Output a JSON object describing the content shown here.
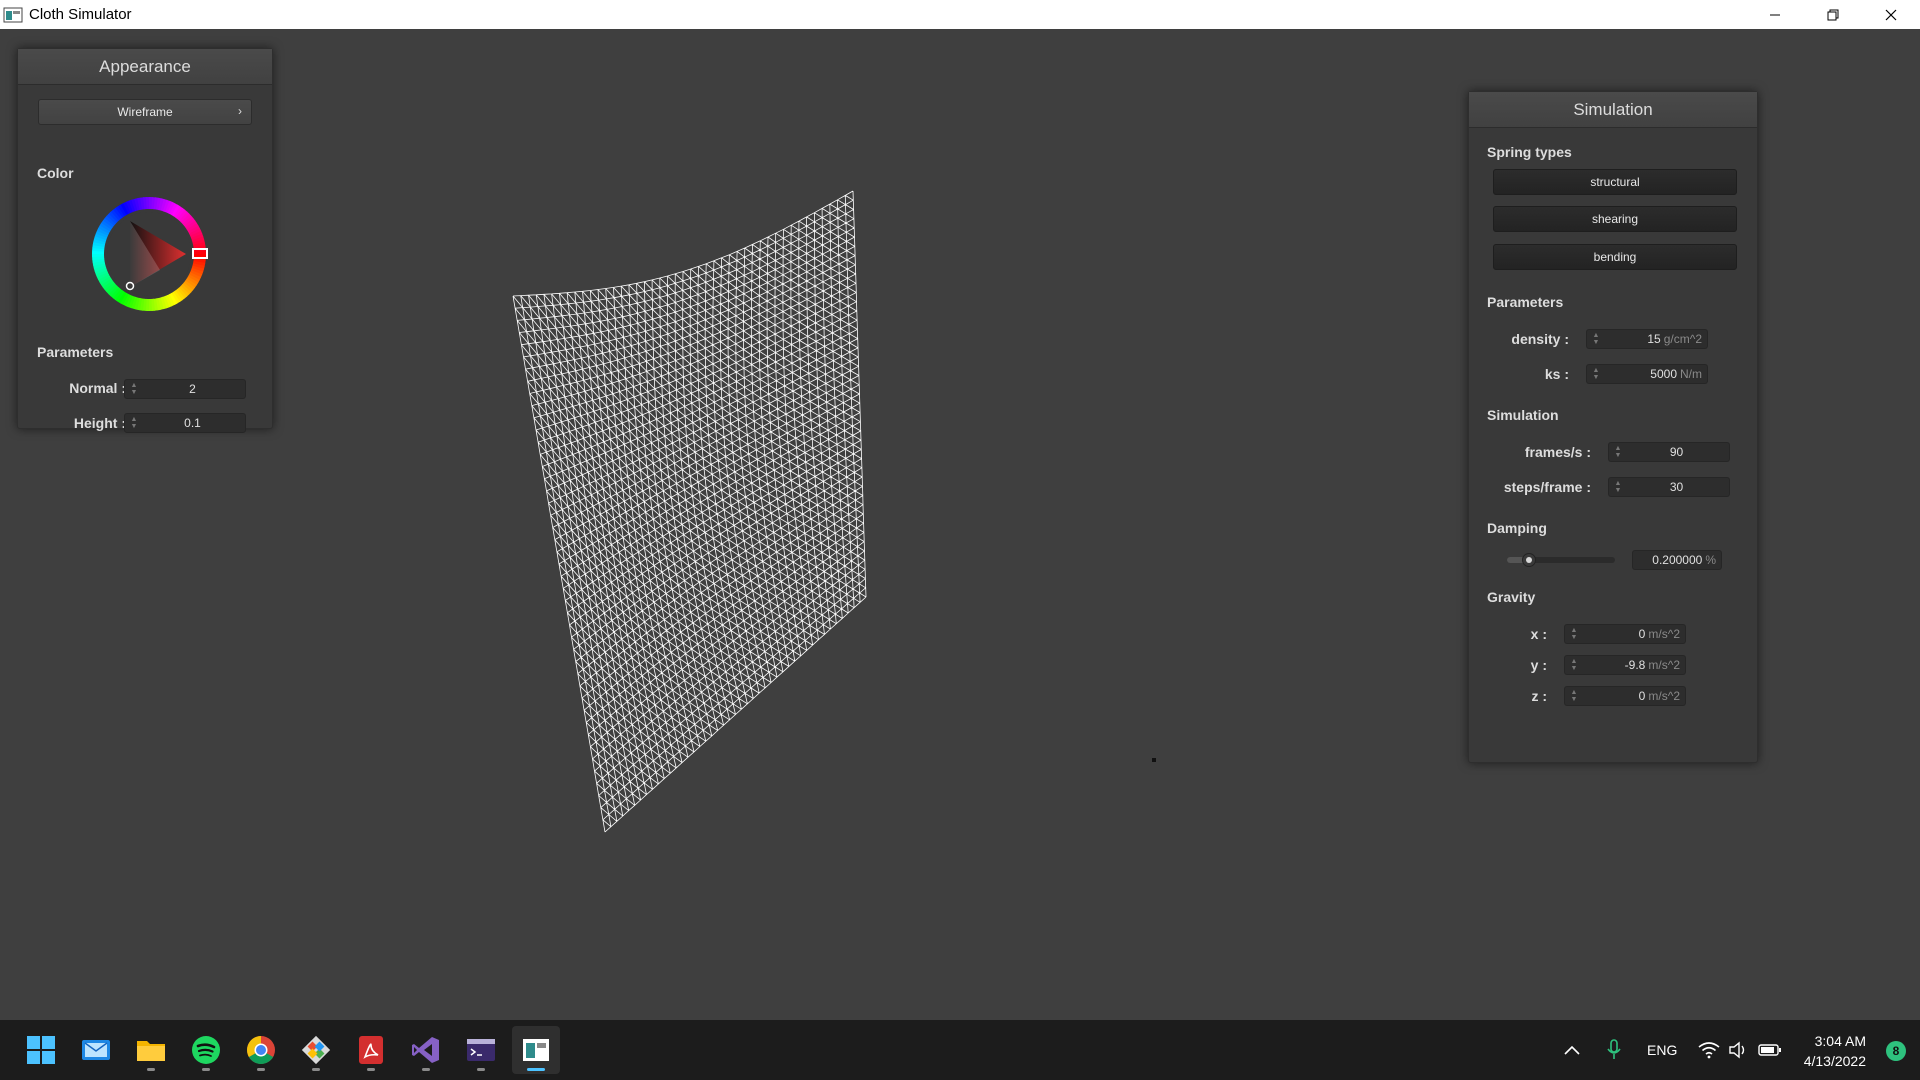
{
  "window": {
    "title": "Cloth Simulator",
    "minimize_icon": "minimize-icon",
    "restore_icon": "restore-icon",
    "close_icon": "close-icon"
  },
  "appearance": {
    "title": "Appearance",
    "render_mode": "Wireframe",
    "color_label": "Color",
    "parameters_label": "Parameters",
    "normal_label": "Normal :",
    "normal_value": "2",
    "height_label": "Height :",
    "height_value": "0.1"
  },
  "simulation_panel": {
    "title": "Simulation",
    "spring_types_label": "Spring types",
    "spring_buttons": [
      "structural",
      "shearing",
      "bending"
    ],
    "parameters_label": "Parameters",
    "density_label": "density :",
    "density_value": "15",
    "density_unit": "g/cm^2",
    "ks_label": "ks :",
    "ks_value": "5000",
    "ks_unit": "N/m",
    "simulation_label": "Simulation",
    "fps_label": "frames/s :",
    "fps_value": "90",
    "steps_label": "steps/frame :",
    "steps_value": "30",
    "damping_label": "Damping",
    "damping_value": "0.200000",
    "damping_unit": "%",
    "damping_fraction": 0.2,
    "gravity_label": "Gravity",
    "gx_label": "x :",
    "gx_value": "0",
    "gy_label": "y :",
    "gy_value": "-9.8",
    "gz_label": "z :",
    "gz_value": "0",
    "gravity_unit": "m/s^2"
  },
  "taskbar": {
    "apps": [
      "windows-start-icon",
      "mail-icon",
      "file-explorer-icon",
      "spotify-icon",
      "chrome-icon",
      "git-icon",
      "acrobat-icon",
      "visual-studio-icon",
      "terminal-icon",
      "cloth-simulator-icon"
    ],
    "language": "ENG",
    "time": "3:04 AM",
    "date": "4/13/2022",
    "notification_count": "8"
  },
  "colors": {
    "cloth_color": "#ffffff",
    "viewport_bg": "#3f3f3f",
    "accent": "#4cc2ff"
  }
}
